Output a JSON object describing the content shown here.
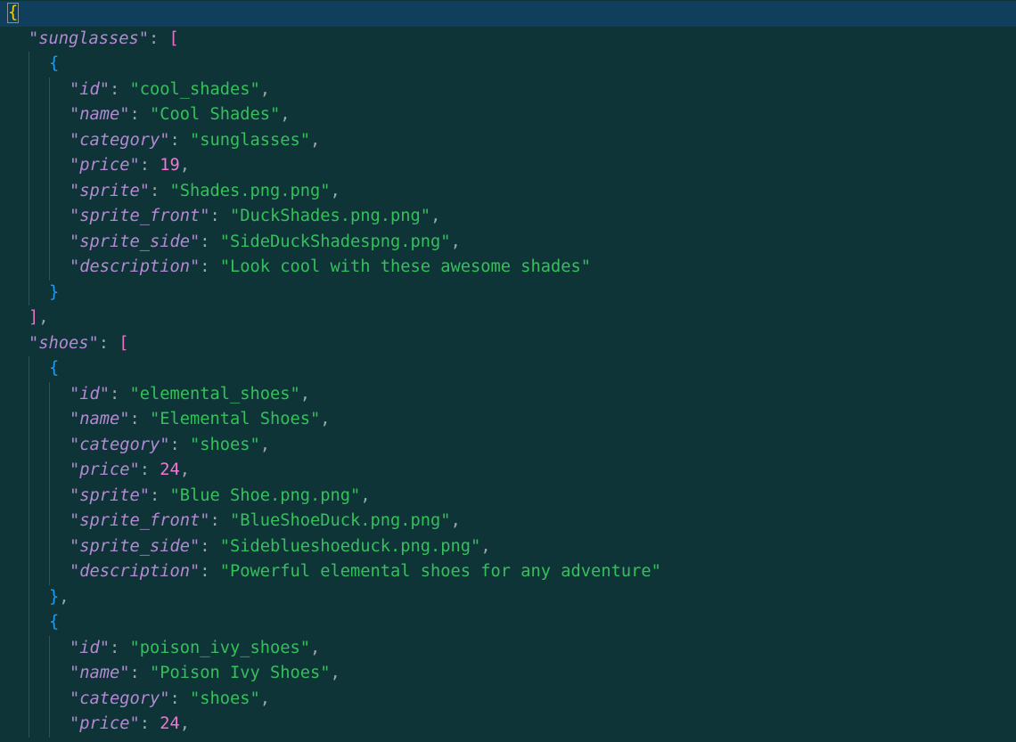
{
  "colors": {
    "background": "#0f3438",
    "current_line": "#103f5d",
    "key": "#b48ad4",
    "string": "#34c05b",
    "number": "#ee79d0",
    "bracket_level_1": "#f2d000",
    "bracket_level_2": "#e86fc6",
    "bracket_level_3": "#1f9bf0",
    "punctuation": "#9aa8ab"
  },
  "lines": [
    {
      "tokens": [
        {
          "t": "{",
          "c": "bracket-y"
        }
      ]
    },
    {
      "tokens": [
        {
          "t": "\"sunglasses\"",
          "c": "key"
        },
        {
          "t": ": ",
          "c": "punct"
        },
        {
          "t": "[",
          "c": "bracket-p"
        }
      ]
    },
    {
      "tokens": [
        {
          "t": "{",
          "c": "bracket-b"
        }
      ]
    },
    {
      "tokens": [
        {
          "t": "\"id\"",
          "c": "key"
        },
        {
          "t": ": ",
          "c": "punct"
        },
        {
          "t": "\"cool_shades\"",
          "c": "str"
        },
        {
          "t": ",",
          "c": "punct"
        }
      ]
    },
    {
      "tokens": [
        {
          "t": "\"name\"",
          "c": "key"
        },
        {
          "t": ": ",
          "c": "punct"
        },
        {
          "t": "\"Cool Shades\"",
          "c": "str"
        },
        {
          "t": ",",
          "c": "punct"
        }
      ]
    },
    {
      "tokens": [
        {
          "t": "\"category\"",
          "c": "key"
        },
        {
          "t": ": ",
          "c": "punct"
        },
        {
          "t": "\"sunglasses\"",
          "c": "str"
        },
        {
          "t": ",",
          "c": "punct"
        }
      ]
    },
    {
      "tokens": [
        {
          "t": "\"price\"",
          "c": "key"
        },
        {
          "t": ": ",
          "c": "punct"
        },
        {
          "t": "19",
          "c": "num"
        },
        {
          "t": ",",
          "c": "punct"
        }
      ]
    },
    {
      "tokens": [
        {
          "t": "\"sprite\"",
          "c": "key"
        },
        {
          "t": ": ",
          "c": "punct"
        },
        {
          "t": "\"Shades.png.png\"",
          "c": "str"
        },
        {
          "t": ",",
          "c": "punct"
        }
      ]
    },
    {
      "tokens": [
        {
          "t": "\"sprite_front\"",
          "c": "key"
        },
        {
          "t": ": ",
          "c": "punct"
        },
        {
          "t": "\"DuckShades.png.png\"",
          "c": "str"
        },
        {
          "t": ",",
          "c": "punct"
        }
      ]
    },
    {
      "tokens": [
        {
          "t": "\"sprite_side\"",
          "c": "key"
        },
        {
          "t": ": ",
          "c": "punct"
        },
        {
          "t": "\"SideDuckShadespng.png\"",
          "c": "str"
        },
        {
          "t": ",",
          "c": "punct"
        }
      ]
    },
    {
      "tokens": [
        {
          "t": "\"description\"",
          "c": "key"
        },
        {
          "t": ": ",
          "c": "punct"
        },
        {
          "t": "\"Look cool with these awesome shades\"",
          "c": "str"
        }
      ]
    },
    {
      "tokens": [
        {
          "t": "}",
          "c": "bracket-b"
        }
      ]
    },
    {
      "tokens": [
        {
          "t": "]",
          "c": "bracket-p"
        },
        {
          "t": ",",
          "c": "punct"
        }
      ]
    },
    {
      "tokens": [
        {
          "t": "\"shoes\"",
          "c": "key"
        },
        {
          "t": ": ",
          "c": "punct"
        },
        {
          "t": "[",
          "c": "bracket-p"
        }
      ]
    },
    {
      "tokens": [
        {
          "t": "{",
          "c": "bracket-b"
        }
      ]
    },
    {
      "tokens": [
        {
          "t": "\"id\"",
          "c": "key"
        },
        {
          "t": ": ",
          "c": "punct"
        },
        {
          "t": "\"elemental_shoes\"",
          "c": "str"
        },
        {
          "t": ",",
          "c": "punct"
        }
      ]
    },
    {
      "tokens": [
        {
          "t": "\"name\"",
          "c": "key"
        },
        {
          "t": ": ",
          "c": "punct"
        },
        {
          "t": "\"Elemental Shoes\"",
          "c": "str"
        },
        {
          "t": ",",
          "c": "punct"
        }
      ]
    },
    {
      "tokens": [
        {
          "t": "\"category\"",
          "c": "key"
        },
        {
          "t": ": ",
          "c": "punct"
        },
        {
          "t": "\"shoes\"",
          "c": "str"
        },
        {
          "t": ",",
          "c": "punct"
        }
      ]
    },
    {
      "tokens": [
        {
          "t": "\"price\"",
          "c": "key"
        },
        {
          "t": ": ",
          "c": "punct"
        },
        {
          "t": "24",
          "c": "num"
        },
        {
          "t": ",",
          "c": "punct"
        }
      ]
    },
    {
      "tokens": [
        {
          "t": "\"sprite\"",
          "c": "key"
        },
        {
          "t": ": ",
          "c": "punct"
        },
        {
          "t": "\"Blue Shoe.png.png\"",
          "c": "str"
        },
        {
          "t": ",",
          "c": "punct"
        }
      ]
    },
    {
      "tokens": [
        {
          "t": "\"sprite_front\"",
          "c": "key"
        },
        {
          "t": ": ",
          "c": "punct"
        },
        {
          "t": "\"BlueShoeDuck.png.png\"",
          "c": "str"
        },
        {
          "t": ",",
          "c": "punct"
        }
      ]
    },
    {
      "tokens": [
        {
          "t": "\"sprite_side\"",
          "c": "key"
        },
        {
          "t": ": ",
          "c": "punct"
        },
        {
          "t": "\"Sideblueshoeduck.png.png\"",
          "c": "str"
        },
        {
          "t": ",",
          "c": "punct"
        }
      ]
    },
    {
      "tokens": [
        {
          "t": "\"description\"",
          "c": "key"
        },
        {
          "t": ": ",
          "c": "punct"
        },
        {
          "t": "\"Powerful elemental shoes for any adventure\"",
          "c": "str"
        }
      ]
    },
    {
      "tokens": [
        {
          "t": "}",
          "c": "bracket-b"
        },
        {
          "t": ",",
          "c": "punct"
        }
      ]
    },
    {
      "tokens": [
        {
          "t": "{",
          "c": "bracket-b"
        }
      ]
    },
    {
      "tokens": [
        {
          "t": "\"id\"",
          "c": "key"
        },
        {
          "t": ": ",
          "c": "punct"
        },
        {
          "t": "\"poison_ivy_shoes\"",
          "c": "str"
        },
        {
          "t": ",",
          "c": "punct"
        }
      ]
    },
    {
      "tokens": [
        {
          "t": "\"name\"",
          "c": "key"
        },
        {
          "t": ": ",
          "c": "punct"
        },
        {
          "t": "\"Poison Ivy Shoes\"",
          "c": "str"
        },
        {
          "t": ",",
          "c": "punct"
        }
      ]
    },
    {
      "tokens": [
        {
          "t": "\"category\"",
          "c": "key"
        },
        {
          "t": ": ",
          "c": "punct"
        },
        {
          "t": "\"shoes\"",
          "c": "str"
        },
        {
          "t": ",",
          "c": "punct"
        }
      ]
    },
    {
      "tokens": [
        {
          "t": "\"price\"",
          "c": "key"
        },
        {
          "t": ": ",
          "c": "punct"
        },
        {
          "t": "24",
          "c": "num"
        },
        {
          "t": ",",
          "c": "punct"
        }
      ]
    }
  ]
}
